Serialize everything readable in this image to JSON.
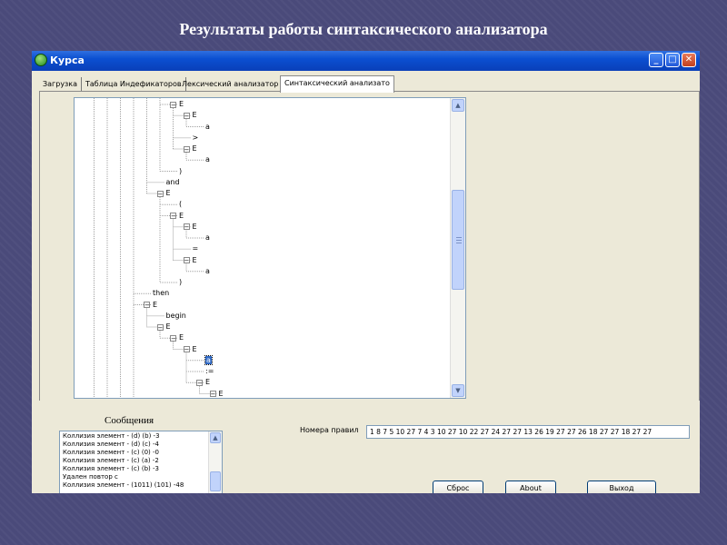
{
  "slide": {
    "title": "Результаты работы синтаксического анализатора"
  },
  "window": {
    "title": "Курса",
    "buttons": {
      "minimize": "_",
      "maximize": "□",
      "close": "✕"
    }
  },
  "tabs": [
    {
      "label": "Загрузка"
    },
    {
      "label": "Таблица Индефикаторов"
    },
    {
      "label": "Лексический анализатор"
    },
    {
      "label": "Синтаксический анализато",
      "active": true
    }
  ],
  "tree": {
    "nodes": [
      {
        "label": "E",
        "level": 6,
        "expandable": true
      },
      {
        "label": "E",
        "level": 7,
        "expandable": true
      },
      {
        "label": "a",
        "level": 8
      },
      {
        "label": ">",
        "level": 7
      },
      {
        "label": "E",
        "level": 7,
        "expandable": true
      },
      {
        "label": "a",
        "level": 8
      },
      {
        "label": ")",
        "level": 6
      },
      {
        "label": "and",
        "level": 5
      },
      {
        "label": "E",
        "level": 5,
        "expandable": true
      },
      {
        "label": "(",
        "level": 6
      },
      {
        "label": "E",
        "level": 6,
        "expandable": true
      },
      {
        "label": "E",
        "level": 7,
        "expandable": true
      },
      {
        "label": "a",
        "level": 8
      },
      {
        "label": "=",
        "level": 7
      },
      {
        "label": "E",
        "level": 7,
        "expandable": true
      },
      {
        "label": "a",
        "level": 8
      },
      {
        "label": ")",
        "level": 6
      },
      {
        "label": "then",
        "level": 4
      },
      {
        "label": "E",
        "level": 4,
        "expandable": true
      },
      {
        "label": "begin",
        "level": 5
      },
      {
        "label": "E",
        "level": 5,
        "expandable": true
      },
      {
        "label": "E",
        "level": 6,
        "expandable": true
      },
      {
        "label": "E",
        "level": 7,
        "expandable": true
      },
      {
        "label": "a",
        "level": 8,
        "selected": true
      },
      {
        "label": ":=",
        "level": 8
      },
      {
        "label": "E",
        "level": 8,
        "expandable": true
      },
      {
        "label": "E",
        "level": 9,
        "expandable": true
      }
    ],
    "scroll_position": 0.45
  },
  "messages": {
    "heading": "Сообщения",
    "items": [
      "Коллизия элемент - (d)  (b) -3",
      "Коллизия элемент - (d)  (c) -4",
      "Коллизия элемент - (c)  (0) -0",
      "Коллизия элемент - (c)  (a) -2",
      "Коллизия элемент - (c)  (b) -3",
      "Удален повтор с",
      "Коллизия элемент - (1011)  (101) -48"
    ]
  },
  "rules": {
    "label": "Номера  правил",
    "value": "1 8 7 5 10 27 7 4 3 10 27 10 22 27 24 27 27 13 26 19 27 27 26 18 27 27 18 27 27"
  },
  "buttons": {
    "reset": "Сброс",
    "about": "About",
    "exit": "Выход"
  },
  "icons": {
    "scroll_up": "▲",
    "scroll_down": "▼",
    "collapse": "−"
  },
  "colors": {
    "titlebar": "#0b4fd1",
    "selection": "#316ac5",
    "slide_bg": "#4a4a7a"
  }
}
